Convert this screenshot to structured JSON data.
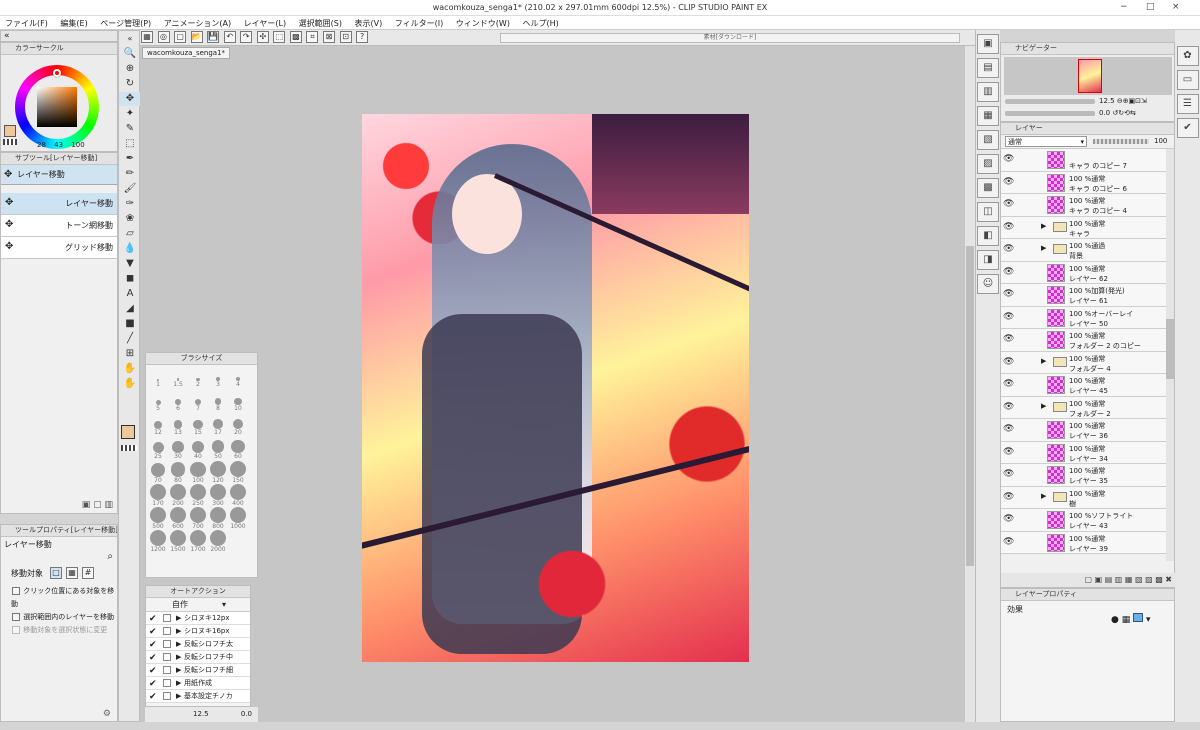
{
  "window": {
    "title": "wacomkouza_senga1* (210.02 x 297.01mm 600dpi 12.5%) - CLIP STUDIO PAINT EX",
    "controls": [
      "−",
      "□",
      "×"
    ]
  },
  "menu": [
    "ファイル(F)",
    "編集(E)",
    "ページ管理(P)",
    "アニメーション(A)",
    "レイヤー(L)",
    "選択範囲(S)",
    "表示(V)",
    "フィルター(I)",
    "ウィンドウ(W)",
    "ヘルプ(H)"
  ],
  "color_circle": {
    "tab": "カラーサークル",
    "values": [
      "28",
      "43",
      "100"
    ],
    "accent": "#6b3a1a"
  },
  "sub_tool": {
    "tab": "サブツール[レイヤー移動]",
    "group": "レイヤー移動",
    "items": [
      "レイヤー移動",
      "トーン網移動",
      "グリッド移動"
    ]
  },
  "tool_property": {
    "tab": "ツールプロパティ[レイヤー移動]",
    "title": "レイヤー移動",
    "move_target_label": "移動対象",
    "options": [
      "クリック位置にある対象を移動",
      "選択範囲内のレイヤーを移動",
      "移動対象を選択状態に変更"
    ]
  },
  "canvas": {
    "tab": "wacomkouza_senga1*",
    "palette_title": "素材[ダウンロード]"
  },
  "brush_size": {
    "title": "ブラシサイズ",
    "sizes": [
      "1",
      "1.5",
      "2",
      "3",
      "4",
      "5",
      "6",
      "7",
      "8",
      "10",
      "12",
      "13",
      "15",
      "17",
      "20",
      "25",
      "30",
      "40",
      "50",
      "60",
      "70",
      "80",
      "100",
      "120",
      "150",
      "170",
      "200",
      "250",
      "300",
      "400",
      "500",
      "600",
      "700",
      "800",
      "1000",
      "1200",
      "1500",
      "1700",
      "2000"
    ]
  },
  "auto_action": {
    "title": "オートアクション",
    "set": "自作",
    "items": [
      "シロヌキ12px",
      "シロヌキ16px",
      "反転シロフチ太",
      "反転シロフチ中",
      "反転シロフチ細",
      "用紙作成",
      "基本設定チノカ"
    ]
  },
  "status": {
    "zoom": "12.5",
    "angle": "0.0"
  },
  "navigator": {
    "tab": "ナビゲーター",
    "zoom": "12.5",
    "angle": "0.0"
  },
  "layer_panel": {
    "tab": "レイヤー",
    "blend": "通常",
    "opacity": "100",
    "rows": [
      {
        "kind": "layer",
        "l1": "",
        "l2": "キャラ のコピー 7"
      },
      {
        "kind": "layer",
        "l1": "100 %通常",
        "l2": "キャラ のコピー 6"
      },
      {
        "kind": "layer",
        "l1": "100 %通常",
        "l2": "キャラ のコピー 4"
      },
      {
        "kind": "folder",
        "l1": "100 %通常",
        "l2": "キャラ"
      },
      {
        "kind": "folder",
        "l1": "100 %通過",
        "l2": "背景"
      },
      {
        "kind": "layer",
        "l1": "100 %通常",
        "l2": "レイヤー 62"
      },
      {
        "kind": "layer",
        "l1": "100 %加算(発光)",
        "l2": "レイヤー 61"
      },
      {
        "kind": "layer",
        "l1": "100 %オーバーレイ",
        "l2": "レイヤー 50"
      },
      {
        "kind": "layer",
        "l1": "100 %通常",
        "l2": "フォルダー 2 のコピー"
      },
      {
        "kind": "folder",
        "l1": "100 %通常",
        "l2": "フォルダー 4"
      },
      {
        "kind": "layer",
        "l1": "100 %通常",
        "l2": "レイヤー 45"
      },
      {
        "kind": "folder",
        "l1": "100 %通常",
        "l2": "フォルダー 2"
      },
      {
        "kind": "layer",
        "l1": "100 %通常",
        "l2": "レイヤー 36"
      },
      {
        "kind": "layer",
        "l1": "100 %通常",
        "l2": "レイヤー 34"
      },
      {
        "kind": "layer",
        "l1": "100 %通常",
        "l2": "レイヤー 35"
      },
      {
        "kind": "folder",
        "l1": "100 %通常",
        "l2": "樹"
      },
      {
        "kind": "layer",
        "l1": "100 %ソフトライト",
        "l2": "レイヤー 43"
      },
      {
        "kind": "layer",
        "l1": "100 %通常",
        "l2": "レイヤー 39"
      }
    ]
  },
  "layer_property": {
    "tab": "レイヤープロパティ",
    "effect_label": "効果"
  }
}
